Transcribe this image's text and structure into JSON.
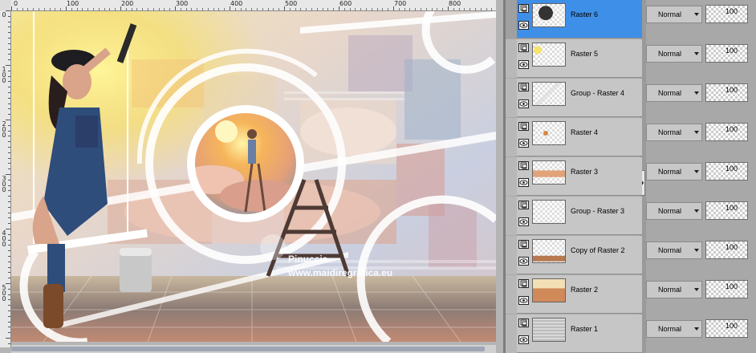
{
  "ruler": {
    "top_labels": [
      "0",
      "100",
      "200",
      "300",
      "400",
      "500",
      "600",
      "700",
      "800"
    ],
    "left_labels": [
      "0",
      "100",
      "200",
      "300",
      "400",
      "500"
    ]
  },
  "canvas": {
    "watermark_line1": "Pinuccia",
    "watermark_line2": "www.maidiregrafica.eu"
  },
  "layers": [
    {
      "name": "Raster 6",
      "blend": "Normal",
      "opacity": "100",
      "selected": true
    },
    {
      "name": "Raster 5",
      "blend": "Normal",
      "opacity": "100",
      "selected": false
    },
    {
      "name": "Group - Raster 4",
      "blend": "Normal",
      "opacity": "100",
      "selected": false
    },
    {
      "name": "Raster 4",
      "blend": "Normal",
      "opacity": "100",
      "selected": false
    },
    {
      "name": "Raster 3",
      "blend": "Normal",
      "opacity": "100",
      "selected": false
    },
    {
      "name": "Group - Raster 3",
      "blend": "Normal",
      "opacity": "100",
      "selected": false
    },
    {
      "name": "Copy of Raster 2",
      "blend": "Normal",
      "opacity": "100",
      "selected": false
    },
    {
      "name": "Raster 2",
      "blend": "Normal",
      "opacity": "100",
      "selected": false
    },
    {
      "name": "Raster 1",
      "blend": "Normal",
      "opacity": "100",
      "selected": false
    }
  ],
  "colors": {
    "selected_row": "#3e8fe8",
    "row": "#c6c6c6",
    "panel": "#a8a8a8"
  }
}
